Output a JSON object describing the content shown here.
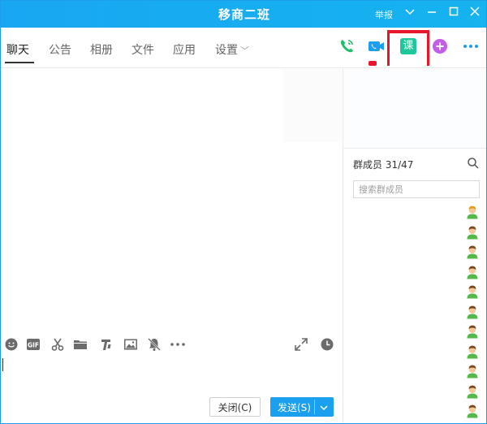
{
  "window": {
    "title": "移商二班",
    "report_label": "举报"
  },
  "tabs": [
    {
      "label": "聊天",
      "active": true
    },
    {
      "label": "公告"
    },
    {
      "label": "相册"
    },
    {
      "label": "文件"
    },
    {
      "label": "应用"
    },
    {
      "label": "设置"
    }
  ],
  "toolbar_icons": {
    "phone": "phone-icon",
    "video": "video-call-icon",
    "lesson": "课",
    "add": "add-icon",
    "more": "more-icon"
  },
  "members": {
    "title": "群成员 31/47",
    "search_placeholder": "搜索群成员",
    "avatar_count": 11
  },
  "input_tools": [
    "emoji-icon",
    "gif-icon",
    "scissors-icon",
    "folder-icon",
    "music-icon",
    "image-icon",
    "bell-off-icon",
    "more-icon",
    "expand-icon",
    "clock-icon"
  ],
  "buttons": {
    "close_label": "关闭(C)",
    "send_label": "发送(S)"
  },
  "colors": {
    "accent": "#1aa0ee",
    "highlight": "#e8162a",
    "lesson_green": "#1fc79a"
  }
}
